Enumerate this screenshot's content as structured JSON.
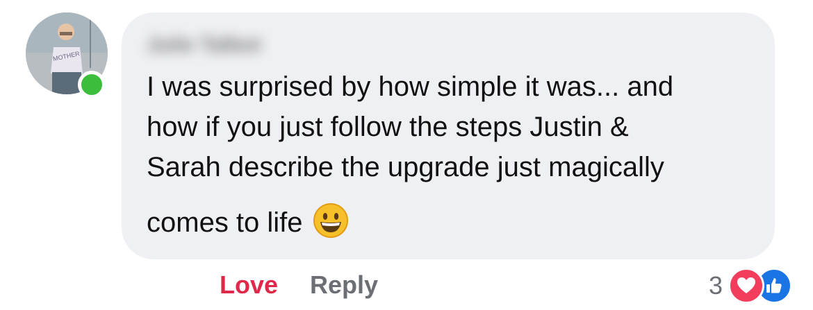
{
  "comment": {
    "author": "Julie Talbot",
    "lines": [
      "I was surprised by how simple it was... and",
      "how if you just follow the steps Justin &",
      "Sarah describe the upgrade just magically"
    ],
    "last_line": "comes to life",
    "emoji": "grinning-face-emoji",
    "avatar_shirt_text": "MOTHER"
  },
  "actions": {
    "love_label": "Love",
    "reply_label": "Reply"
  },
  "reactions": {
    "count": "3",
    "types": [
      "heart",
      "like"
    ]
  },
  "colors": {
    "bubble": "#eff0f3",
    "love": "#e0284a",
    "reply": "#6b6f75",
    "online": "#3cbd3c",
    "heart": "#f23e5c",
    "like": "#1b74e4"
  }
}
